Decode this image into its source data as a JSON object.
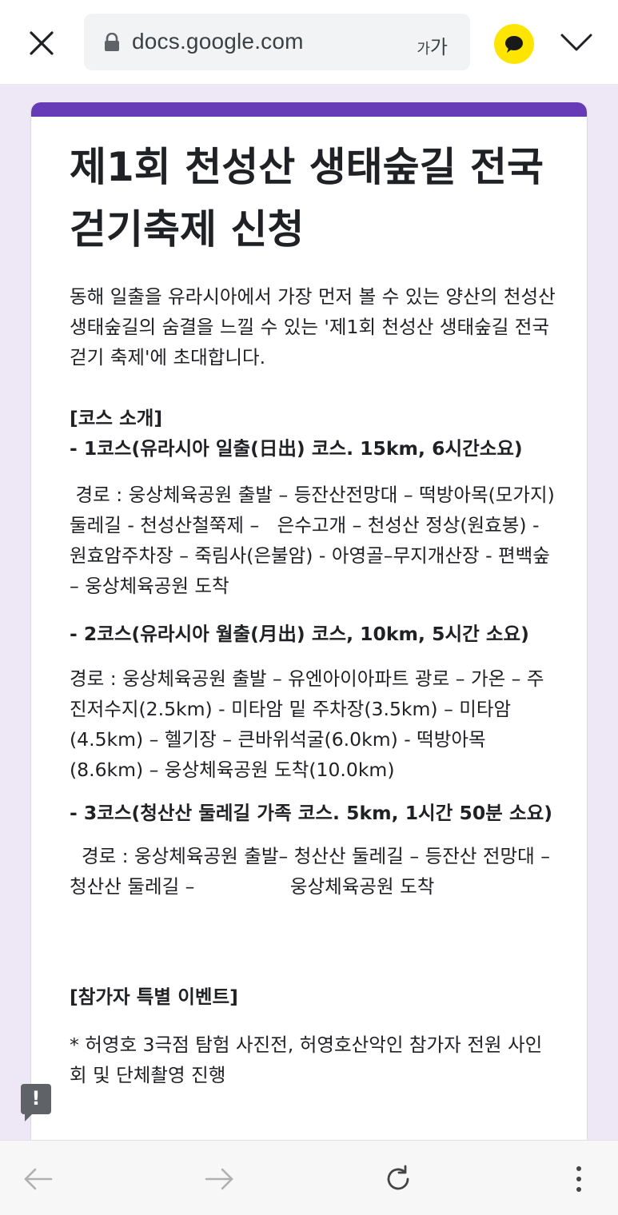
{
  "browser": {
    "url": "docs.google.com",
    "text_size_small": "가",
    "text_size_large": "가",
    "talk_icon": "kakaotalk-speech-bubble-icon",
    "accent_color": "#673ab7"
  },
  "form": {
    "title": "제1회 천성산 생태숲길 전국 걷기축제 신청",
    "intro": "동해 일출을 유라시아에서 가장 먼저 볼 수 있는 양산의 천성산 생태숲길의 숨결을 느낄 수 있는 '제1회 천성산 생태숲길 전국걷기 축제'에 초대합니다.",
    "course_heading": "[코스 소개]",
    "course1_title": "- 1코스(유라시아 일출(日出) 코스. 15km, 6시간소요)",
    "course1_route": " 경로 : 웅상체육공원 출발 – 등잔산전망대 – 떡방아목(모가지) 둘레길 - 천성산철쭉제 –   은수고개 – 천성산 정상(원효봉) - 원효암주차장 – 죽림사(은불암) - 아영골–무지개산장 - 편백숲 – 웅상체육공원 도착",
    "course2_title": "- 2코스(유라시아 월출(月出) 코스, 10km, 5시간 소요)",
    "course2_route": "경로 : 웅상체육공원 출발 – 유엔아이아파트 광로 – 가온 – 주진저수지(2.5km) - 미타암 밑 주차장(3.5km) – 미타암(4.5km) – 헬기장 – 큰바위석굴(6.0km) - 떡방아목(8.6km) – 웅상체육공원 도착(10.0km)",
    "course3_title": "- 3코스(청산산 둘레길 가족 코스. 5km, 1시간 50분 소요)",
    "course3_route": "  경로 : 웅상체육공원 출발– 청산산 둘레길 – 등잔산 전망대 – 청산산 둘레길 –                웅상체육공원 도착",
    "event_heading": "[참가자 특별 이벤트]",
    "event_item": "* 허영호 3극점 탐험 사진전, 허영호산악인 참가자 전원 사인회 및 단체촬영 진행"
  },
  "feedback": {
    "mark": "!"
  }
}
